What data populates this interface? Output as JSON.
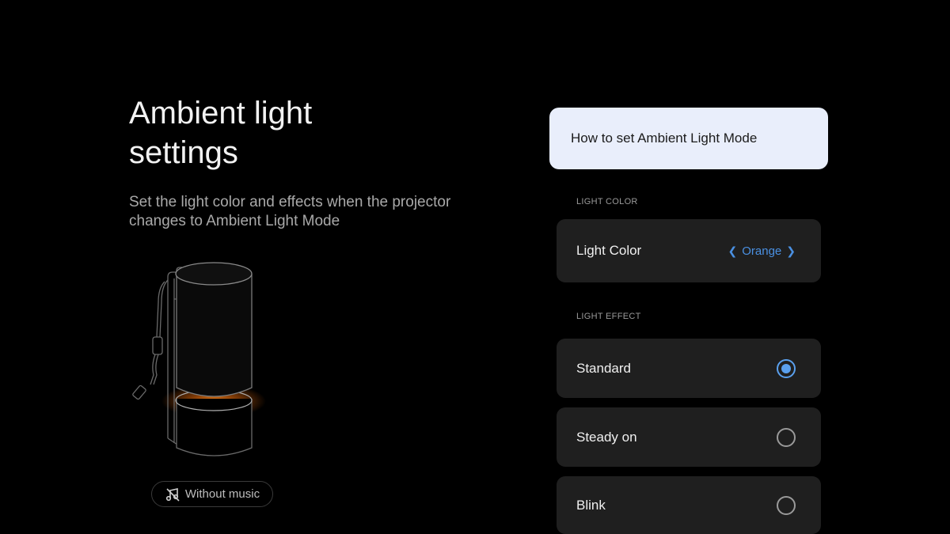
{
  "page": {
    "title": "Ambient light settings",
    "subtitle": "Set the light color and effects when the projector changes to Ambient Light Mode"
  },
  "music_button": {
    "icon": "music-off-icon",
    "label": "Without music"
  },
  "howto_button": {
    "label": "How to set Ambient Light Mode"
  },
  "light_color": {
    "section_label": "LIGHT COLOR",
    "item_label": "Light Color",
    "value": "Orange",
    "prev_icon": "chevron-left-icon",
    "next_icon": "chevron-right-icon"
  },
  "light_effect": {
    "section_label": "LIGHT EFFECT",
    "options": [
      {
        "label": "Standard",
        "selected": true
      },
      {
        "label": "Steady on",
        "selected": false
      },
      {
        "label": "Blink",
        "selected": false
      }
    ]
  },
  "colors": {
    "accent": "#4a90e2",
    "glow": "#ff8a1e",
    "card_bg": "#1f1f1f",
    "howto_bg": "#e9eefb"
  }
}
